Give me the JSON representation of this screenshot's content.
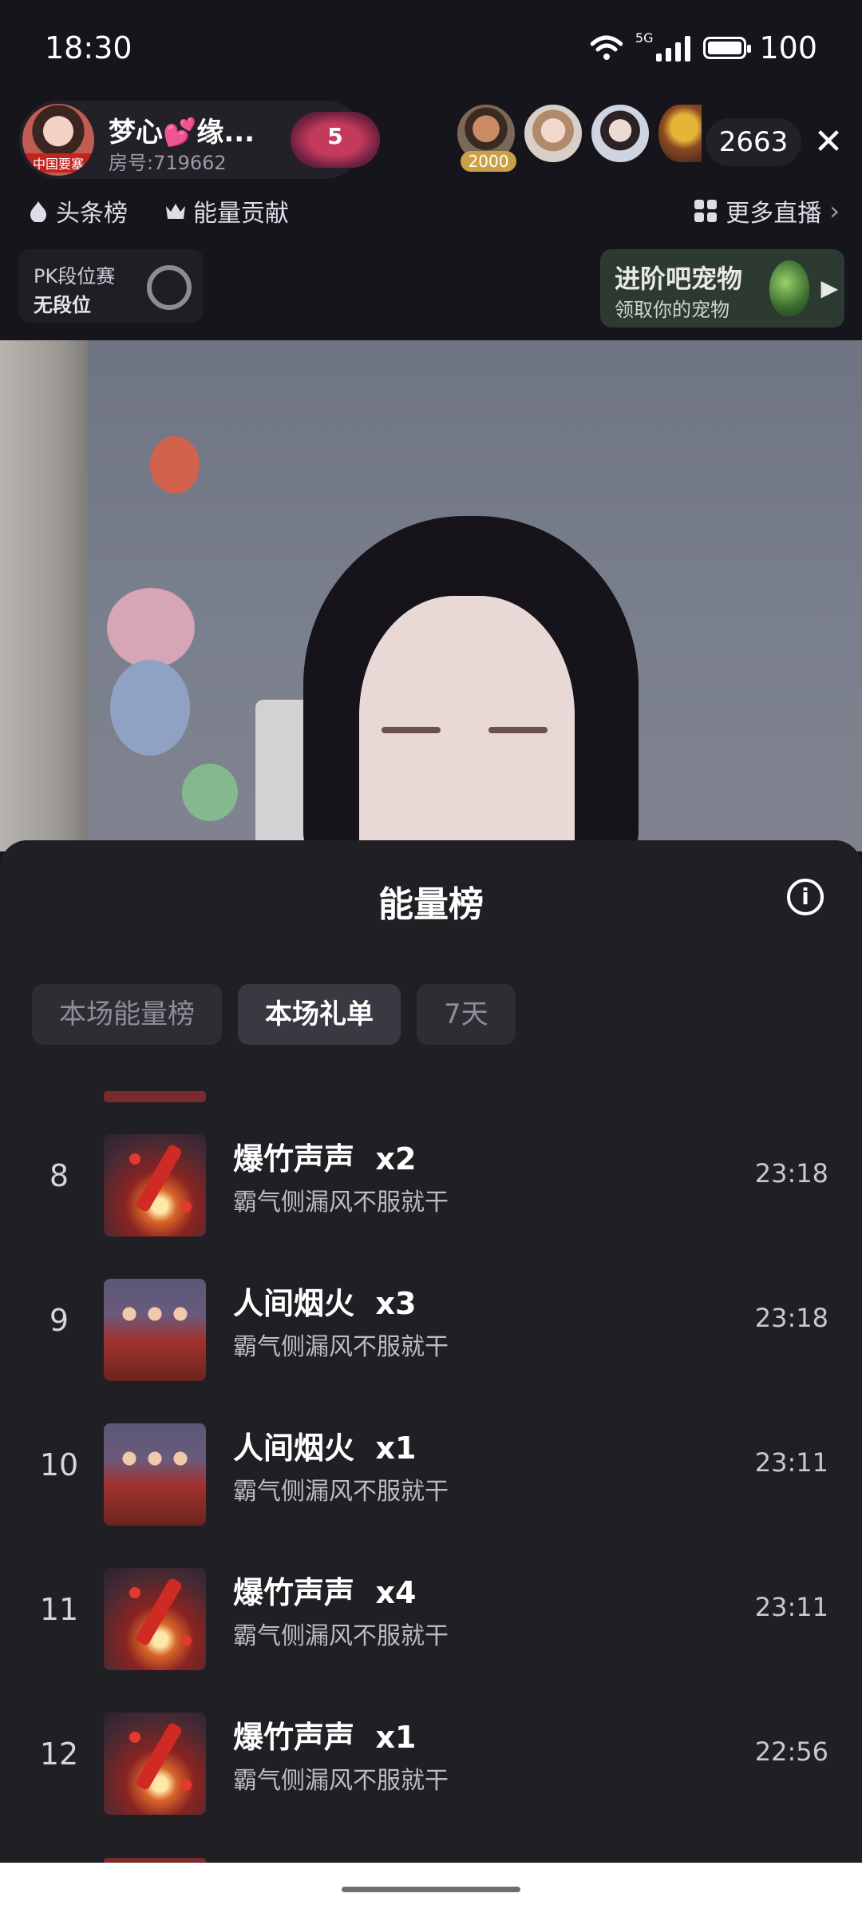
{
  "status_bar": {
    "time": "18:30",
    "network": "5G",
    "battery": "100"
  },
  "host": {
    "name": "梦心💕缘...",
    "room": "房号:719662",
    "level": "5",
    "avatar_tag": "中国要塞"
  },
  "viewers": {
    "badge": "2000",
    "count": "2663"
  },
  "chips": {
    "headline": "头条榜",
    "energy": "能量贡献",
    "more_live": "更多直播"
  },
  "pk": {
    "title": "PK段位赛",
    "rank": "无段位"
  },
  "pet": {
    "title": "进阶吧宠物",
    "subtitle": "领取你的宠物"
  },
  "sheet": {
    "title": "能量榜",
    "tabs": [
      "本场能量榜",
      "本场礼单",
      "7天"
    ],
    "active_tab": "本场礼单",
    "rows": [
      {
        "rank": "8",
        "gift": "爆竹声声",
        "qty": "x2",
        "sender": "霸气侧漏风不服就干",
        "time": "23:18",
        "icon": "firecracker-icon"
      },
      {
        "rank": "9",
        "gift": "人间烟火",
        "qty": "x3",
        "sender": "霸气侧漏风不服就干",
        "time": "23:18",
        "icon": "family-dinner-icon"
      },
      {
        "rank": "10",
        "gift": "人间烟火",
        "qty": "x1",
        "sender": "霸气侧漏风不服就干",
        "time": "23:11",
        "icon": "family-dinner-icon"
      },
      {
        "rank": "11",
        "gift": "爆竹声声",
        "qty": "x4",
        "sender": "霸气侧漏风不服就干",
        "time": "23:11",
        "icon": "firecracker-icon"
      },
      {
        "rank": "12",
        "gift": "爆竹声声",
        "qty": "x1",
        "sender": "霸气侧漏风不服就干",
        "time": "22:56",
        "icon": "firecracker-icon"
      }
    ]
  },
  "colors": {
    "sheet_bg": "#1f1f24",
    "header_bg": "#16151b",
    "level_badge": "#c43a5c"
  }
}
